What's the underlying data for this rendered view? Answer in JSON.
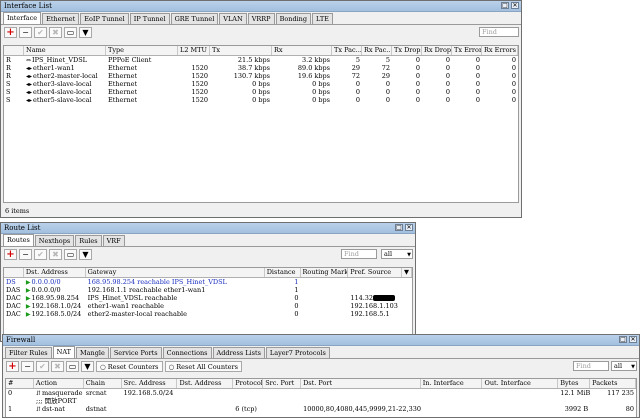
{
  "interface_window": {
    "title": "Interface List",
    "tabs": [
      "Interface",
      "Ethernet",
      "EoIP Tunnel",
      "IP Tunnel",
      "GRE Tunnel",
      "VLAN",
      "VRRP",
      "Bonding",
      "LTE"
    ],
    "find_placeholder": "Find",
    "columns": [
      "Name",
      "Type",
      "L2 MTU",
      "Tx",
      "Rx",
      "Tx Pac...",
      "Rx Pac...",
      "Tx Drops",
      "Rx Drops",
      "Tx Errors",
      "Rx Errors"
    ],
    "rows": [
      {
        "flag": "R",
        "name": "IPS_Hinet_VDSL",
        "type": "PPPoE Client",
        "l2mtu": "",
        "tx": "21.5 kbps",
        "rx": "3.2 kbps",
        "txp": "5",
        "rxp": "5",
        "txd": "0",
        "rxd": "0",
        "txe": "0",
        "rxe": "0"
      },
      {
        "flag": "R",
        "name": "ether1-wan1",
        "type": "Ethernet",
        "l2mtu": "1520",
        "tx": "38.7 kbps",
        "rx": "89.0 kbps",
        "txp": "29",
        "rxp": "72",
        "txd": "0",
        "rxd": "0",
        "txe": "0",
        "rxe": "0"
      },
      {
        "flag": "R",
        "name": "ether2-master-local",
        "type": "Ethernet",
        "l2mtu": "1520",
        "tx": "130.7 kbps",
        "rx": "19.6 kbps",
        "txp": "72",
        "rxp": "29",
        "txd": "0",
        "rxd": "0",
        "txe": "0",
        "rxe": "0"
      },
      {
        "flag": "S",
        "name": "ether3-slave-local",
        "type": "Ethernet",
        "l2mtu": "1520",
        "tx": "0 bps",
        "rx": "0 bps",
        "txp": "0",
        "rxp": "0",
        "txd": "0",
        "rxd": "0",
        "txe": "0",
        "rxe": "0"
      },
      {
        "flag": "S",
        "name": "ether4-slave-local",
        "type": "Ethernet",
        "l2mtu": "1520",
        "tx": "0 bps",
        "rx": "0 bps",
        "txp": "0",
        "rxp": "0",
        "txd": "0",
        "rxd": "0",
        "txe": "0",
        "rxe": "0"
      },
      {
        "flag": "S",
        "name": "ether5-slave-local",
        "type": "Ethernet",
        "l2mtu": "1520",
        "tx": "0 bps",
        "rx": "0 bps",
        "txp": "0",
        "rxp": "0",
        "txd": "0",
        "rxd": "0",
        "txe": "0",
        "rxe": "0"
      }
    ],
    "status": "6 items"
  },
  "route_window": {
    "title": "Route List",
    "tabs": [
      "Routes",
      "Nexthops",
      "Rules",
      "VRF"
    ],
    "find_placeholder": "Find",
    "filter_value": "all",
    "columns": [
      "",
      "Dst. Address",
      "Gateway",
      "Distance",
      "Routing Mark",
      "Pref. Source"
    ],
    "rows": [
      {
        "flag": "DS",
        "dst": "0.0.0.0/0",
        "gw": "168.95.98.254 reachable IPS_Hinet_VDSL",
        "dist": "1",
        "mark": "",
        "src": "",
        "blue": true
      },
      {
        "flag": "DAS",
        "dst": "0.0.0.0/0",
        "gw": "192.168.1.1 reachable ether1-wan1",
        "dist": "1",
        "mark": "",
        "src": "",
        "blue": false
      },
      {
        "flag": "DAC",
        "dst": "168.95.98.254",
        "gw": "IPS_Hinet_VDSL reachable",
        "dist": "0",
        "mark": "",
        "src": "114.32",
        "blue": false
      },
      {
        "flag": "DAC",
        "dst": "192.168.1.0/24",
        "gw": "ether1-wan1 reachable",
        "dist": "0",
        "mark": "",
        "src": "192.168.1.103",
        "blue": false
      },
      {
        "flag": "DAC",
        "dst": "192.168.5.0/24",
        "gw": "ether2-master-local reachable",
        "dist": "0",
        "mark": "",
        "src": "192.168.5.1",
        "blue": false
      }
    ]
  },
  "firewall_window": {
    "title": "Firewall",
    "tabs": [
      "Filter Rules",
      "NAT",
      "Mangle",
      "Service Ports",
      "Connections",
      "Address Lists",
      "Layer7 Protocols"
    ],
    "reset_counters": "Reset Counters",
    "reset_all_counters": "Reset All Counters",
    "find_placeholder": "Find",
    "filter_value": "all",
    "columns": [
      "#",
      "Action",
      "Chain",
      "Src. Address",
      "Dst. Address",
      "Protocol",
      "Src. Port",
      "Dst. Port",
      "In. Interface",
      "Out. Interface",
      "Bytes",
      "Packets"
    ],
    "rows": [
      {
        "num": "0",
        "action": "masquerade",
        "chain": "srcnat",
        "src": "192.168.5.0/24",
        "dst": "",
        "proto": "",
        "sport": "",
        "dport": "",
        "inif": "",
        "outif": "",
        "bytes": "12.1 MiB",
        "packets": "117 235"
      },
      {
        "num": "",
        "action": ";;; 開放PORT",
        "chain": "",
        "src": "",
        "dst": "",
        "proto": "",
        "sport": "",
        "dport": "",
        "inif": "",
        "outif": "",
        "bytes": "",
        "packets": "",
        "comment": true
      },
      {
        "num": "1",
        "action": "dst-nat",
        "chain": "dstnat",
        "src": "",
        "dst": "",
        "proto": "6 (tcp)",
        "sport": "",
        "dport": "10000,80,4080,445,9999,21-22,3306",
        "inif": "",
        "outif": "",
        "bytes": "3992 B",
        "packets": "80"
      }
    ]
  }
}
